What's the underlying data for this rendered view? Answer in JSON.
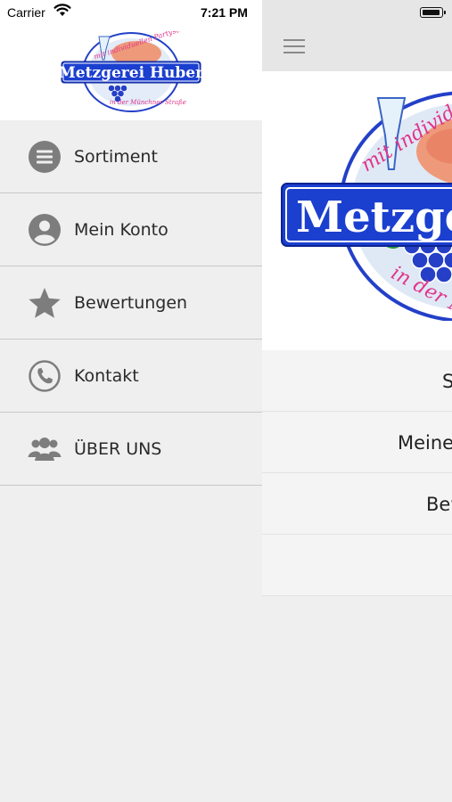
{
  "status_bar": {
    "carrier": "Carrier",
    "time": "7:21 PM"
  },
  "brand": {
    "name": "Metzgerei Huber",
    "tagline_top": "mit individuellen Partyservice",
    "tagline_bottom": "in der Münchner Straße",
    "colors": {
      "blue": "#1b3fcf",
      "pink": "#e23a8a",
      "grape": "#2b3fc0"
    }
  },
  "drawer": {
    "items": [
      {
        "label": "Sortiment",
        "icon": "list-circle-icon"
      },
      {
        "label": "Mein Konto",
        "icon": "user-circle-icon"
      },
      {
        "label": "Bewertungen",
        "icon": "star-icon"
      },
      {
        "label": "Kontakt",
        "icon": "phone-icon"
      },
      {
        "label": "ÜBER UNS",
        "icon": "group-icon"
      }
    ]
  },
  "main": {
    "menu_icon": "hamburger-icon",
    "rows": [
      {
        "label": "Sortiment"
      },
      {
        "label": "Meine"
      },
      {
        "label": "Bewertungen"
      },
      {
        "label": ""
      }
    ]
  }
}
